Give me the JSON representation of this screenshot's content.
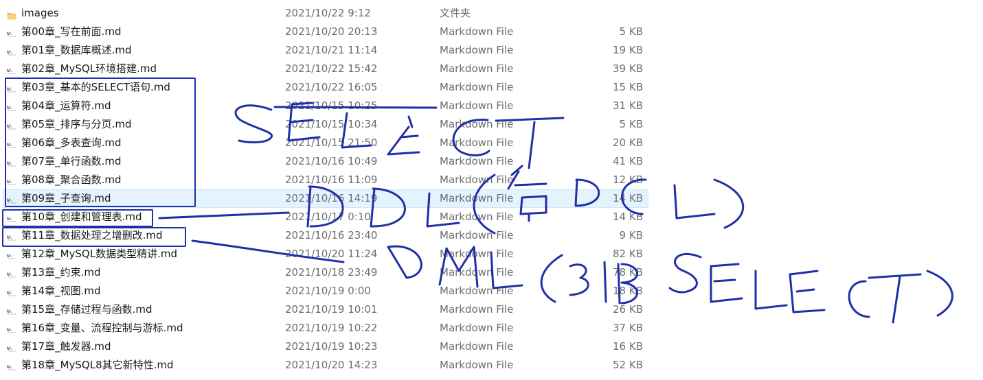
{
  "files": [
    {
      "name": "images",
      "date": "2021/10/22 9:12",
      "type": "文件夹",
      "size": "",
      "icon": "folder-icon"
    },
    {
      "name": "第00章_写在前面.md",
      "date": "2021/10/20 20:13",
      "type": "Markdown File",
      "size": "5 KB",
      "icon": "markdown-file-icon"
    },
    {
      "name": "第01章_数据库概述.md",
      "date": "2021/10/21 11:14",
      "type": "Markdown File",
      "size": "19 KB",
      "icon": "markdown-file-icon"
    },
    {
      "name": "第02章_MySQL环境搭建.md",
      "date": "2021/10/22 15:42",
      "type": "Markdown File",
      "size": "39 KB",
      "icon": "markdown-file-icon"
    },
    {
      "name": "第03章_基本的SELECT语句.md",
      "date": "2021/10/22 16:05",
      "type": "Markdown File",
      "size": "15 KB",
      "icon": "markdown-file-icon"
    },
    {
      "name": "第04章_运算符.md",
      "date": "2021/10/15 10:25",
      "type": "Markdown File",
      "size": "31 KB",
      "icon": "markdown-file-icon"
    },
    {
      "name": "第05章_排序与分页.md",
      "date": "2021/10/15 10:34",
      "type": "Markdown File",
      "size": "5 KB",
      "icon": "markdown-file-icon"
    },
    {
      "name": "第06章_多表查询.md",
      "date": "2021/10/15 21:50",
      "type": "Markdown File",
      "size": "20 KB",
      "icon": "markdown-file-icon"
    },
    {
      "name": "第07章_单行函数.md",
      "date": "2021/10/16 10:49",
      "type": "Markdown File",
      "size": "41 KB",
      "icon": "markdown-file-icon"
    },
    {
      "name": "第08章_聚合函数.md",
      "date": "2021/10/16 11:09",
      "type": "Markdown File",
      "size": "12 KB",
      "icon": "markdown-file-icon"
    },
    {
      "name": "第09章_子查询.md",
      "date": "2021/10/16 14:19",
      "type": "Markdown File",
      "size": "14 KB",
      "icon": "markdown-file-icon",
      "hovered": true
    },
    {
      "name": "第10章_创建和管理表.md",
      "date": "2021/10/17 0:10",
      "type": "Markdown File",
      "size": "14 KB",
      "icon": "markdown-file-icon"
    },
    {
      "name": "第11章_数据处理之增删改.md",
      "date": "2021/10/16 23:40",
      "type": "Markdown File",
      "size": "9 KB",
      "icon": "markdown-file-icon"
    },
    {
      "name": "第12章_MySQL数据类型精讲.md",
      "date": "2021/10/20 11:24",
      "type": "Markdown File",
      "size": "82 KB",
      "icon": "markdown-file-icon"
    },
    {
      "name": "第13章_约束.md",
      "date": "2021/10/18 23:49",
      "type": "Markdown File",
      "size": "78 KB",
      "icon": "markdown-file-icon"
    },
    {
      "name": "第14章_视图.md",
      "date": "2021/10/19 0:00",
      "type": "Markdown File",
      "size": "18 KB",
      "icon": "markdown-file-icon"
    },
    {
      "name": "第15章_存储过程与函数.md",
      "date": "2021/10/19 10:01",
      "type": "Markdown File",
      "size": "26 KB",
      "icon": "markdown-file-icon"
    },
    {
      "name": "第16章_变量、流程控制与游标.md",
      "date": "2021/10/19 10:22",
      "type": "Markdown File",
      "size": "37 KB",
      "icon": "markdown-file-icon"
    },
    {
      "name": "第17章_触发器.md",
      "date": "2021/10/19 10:23",
      "type": "Markdown File",
      "size": "16 KB",
      "icon": "markdown-file-icon"
    },
    {
      "name": "第18章_MySQL8其它新特性.md",
      "date": "2021/10/20 14:23",
      "type": "Markdown File",
      "size": "52 KB",
      "icon": "markdown-file-icon"
    }
  ],
  "colors": {
    "annotation_ink": "#1f2fa8",
    "folder": "#f2c45a",
    "hover_background": "#e5f3ff"
  }
}
